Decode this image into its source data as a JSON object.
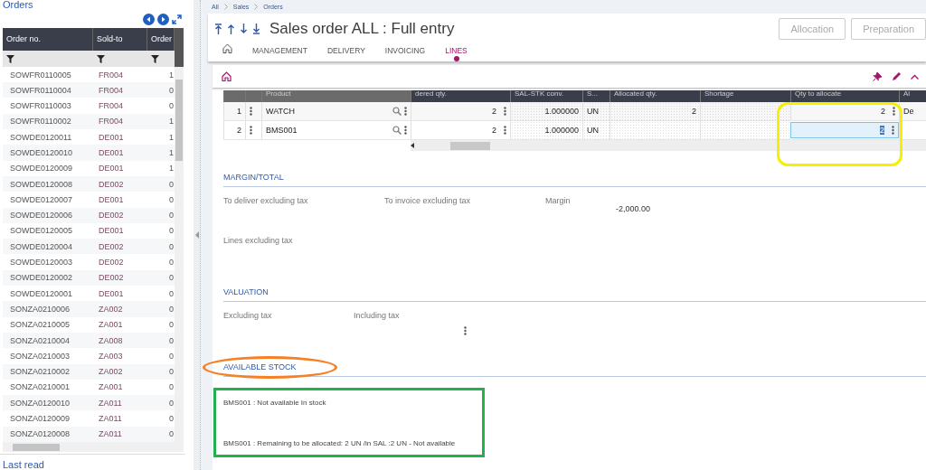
{
  "orders_panel": {
    "title": "Orders",
    "columns": [
      "Order no.",
      "Sold-to",
      "Order"
    ],
    "rows": [
      [
        "SOWFR0110005",
        "FR004",
        "1"
      ],
      [
        "SOWFR0110004",
        "FR004",
        "0"
      ],
      [
        "SOWFR0110003",
        "FR004",
        "0"
      ],
      [
        "SOWFR0110002",
        "FR004",
        "1"
      ],
      [
        "SOWDE0120011",
        "DE001",
        "1"
      ],
      [
        "SOWDE0120010",
        "DE001",
        "1"
      ],
      [
        "SOWDE0120009",
        "DE001",
        "1"
      ],
      [
        "SOWDE0120008",
        "DE002",
        "0"
      ],
      [
        "SOWDE0120007",
        "DE001",
        "0"
      ],
      [
        "SOWDE0120006",
        "DE002",
        "0"
      ],
      [
        "SOWDE0120005",
        "DE001",
        "0"
      ],
      [
        "SOWDE0120004",
        "DE002",
        "0"
      ],
      [
        "SOWDE0120003",
        "DE002",
        "0"
      ],
      [
        "SOWDE0120002",
        "DE002",
        "0"
      ],
      [
        "SOWDE0120001",
        "DE001",
        "0"
      ],
      [
        "SONZA0210006",
        "ZA002",
        "0"
      ],
      [
        "SONZA0210005",
        "ZA001",
        "0"
      ],
      [
        "SONZA0210004",
        "ZA008",
        "0"
      ],
      [
        "SONZA0210003",
        "ZA003",
        "0"
      ],
      [
        "SONZA0210002",
        "ZA002",
        "0"
      ],
      [
        "SONZA0210001",
        "ZA001",
        "0"
      ],
      [
        "SONZA0120010",
        "ZA011",
        "0"
      ],
      [
        "SONZA0120009",
        "ZA011",
        "0"
      ],
      [
        "SONZA0120008",
        "ZA011",
        "0"
      ]
    ],
    "footer": "Last read"
  },
  "breadcrumb": [
    "All",
    "Sales",
    "Orders"
  ],
  "title": "Sales order ALL : Full entry",
  "actions": [
    {
      "label": "Allocation",
      "disabled": true
    },
    {
      "label": "Preparation",
      "disabled": true
    }
  ],
  "tabs": [
    {
      "label": "MANAGEMENT",
      "selected": false
    },
    {
      "label": "DELIVERY",
      "selected": false
    },
    {
      "label": "INVOICING",
      "selected": false
    },
    {
      "label": "LINES",
      "selected": true
    }
  ],
  "lines_table": {
    "columns": [
      "Product",
      "dered qty.",
      "SAL-STK conv.",
      "S...",
      "Allocated qty.",
      "Shortage",
      "Qty to allocate",
      "Al"
    ],
    "rows": [
      {
        "no": "1",
        "product": "WATCH",
        "ordered_qty": "2",
        "conversion": "1.000000",
        "unit": "UN",
        "allocated_qty": "2",
        "qty_to_allocate": "2",
        "column_8": "De",
        "selected": false
      },
      {
        "no": "2",
        "product": "BMS001",
        "ordered_qty": "2",
        "conversion": "1.000000",
        "unit": "UN",
        "qty_to_allocate": "2",
        "selected": true
      }
    ]
  },
  "margin_total": {
    "title": "MARGIN/TOTAL",
    "fields": [
      {
        "label": "To deliver excluding tax"
      },
      {
        "label": "To invoice excluding tax"
      },
      {
        "label": "Margin",
        "value": "-2,000.00"
      },
      {
        "label": "Lines excluding tax"
      }
    ]
  },
  "valuation": {
    "title": "VALUATION",
    "fields": [
      {
        "label": "Excluding tax"
      },
      {
        "label": "Including tax"
      }
    ]
  },
  "available_stock": {
    "title": "AVAILABLE STOCK",
    "messages": [
      "BMS001 : Not available In stock",
      "BMS001 : Remaining to be allocated: 2 UN /in SAL :2 UN - Not available"
    ]
  },
  "annotations": [
    {
      "kind": "rounded",
      "color": "#f5f000"
    },
    {
      "kind": "ellipse",
      "color": "#f58025"
    },
    {
      "kind": "square",
      "color": "#22b14c"
    }
  ]
}
